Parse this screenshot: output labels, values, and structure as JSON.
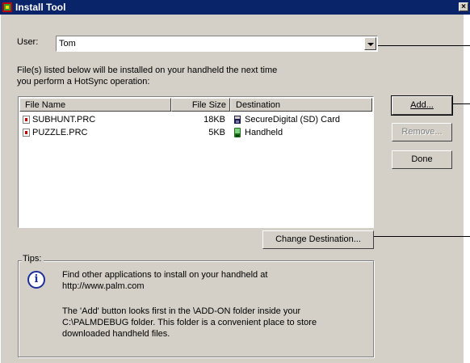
{
  "window": {
    "title": "Install Tool",
    "close_glyph": "×"
  },
  "user": {
    "label": "User:",
    "value": "Tom"
  },
  "instructions": {
    "line1": "File(s) listed below will be installed on your handheld the next time",
    "line2": "you perform a HotSync operation:"
  },
  "list": {
    "columns": {
      "file_name": "File Name",
      "file_size": "File Size",
      "destination": "Destination"
    },
    "rows": [
      {
        "name": "SUBHUNT.PRC",
        "size": "18KB",
        "destination": "SecureDigital (SD) Card",
        "dest_icon": "sd-card-icon"
      },
      {
        "name": "PUZZLE.PRC",
        "size": "5KB",
        "destination": "Handheld",
        "dest_icon": "handheld-icon"
      }
    ]
  },
  "buttons": {
    "add": "Add...",
    "remove": "Remove...",
    "done": "Done",
    "change_destination": "Change Destination..."
  },
  "tips": {
    "legend": "Tips:",
    "line1": "Find other applications to install on your handheld at",
    "line2": "http://www.palm.com",
    "line3": "The 'Add' button looks first in the \\ADD-ON folder inside your",
    "line4": "C:\\PALMDEBUG folder. This folder is a convenient place to store",
    "line5": "downloaded handheld files."
  },
  "colors": {
    "titlebar": "#0a246a",
    "dialog_bg": "#d4d0c8",
    "info_icon": "#1f2f9a"
  }
}
